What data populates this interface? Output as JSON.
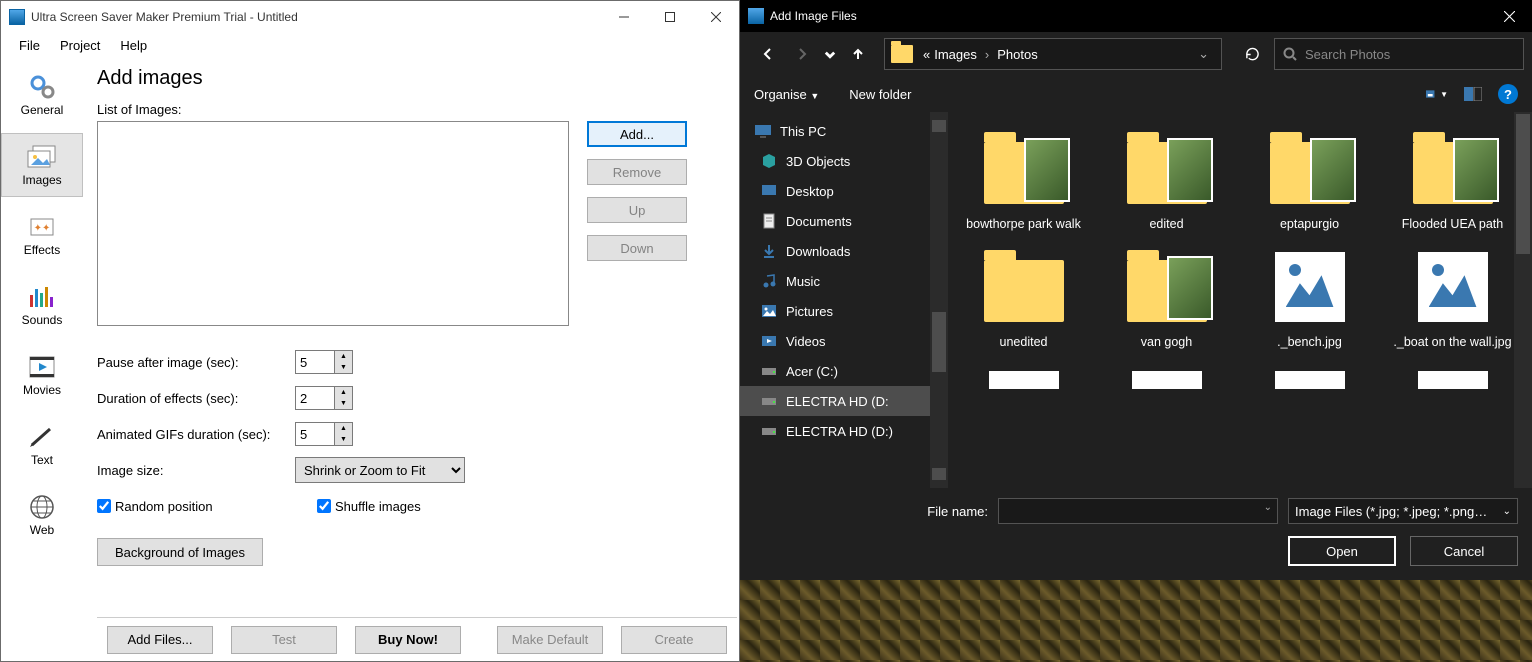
{
  "app": {
    "title": "Ultra Screen Saver Maker Premium Trial - Untitled",
    "menu": [
      "File",
      "Project",
      "Help"
    ],
    "sidebar": [
      {
        "label": "General"
      },
      {
        "label": "Images"
      },
      {
        "label": "Effects"
      },
      {
        "label": "Sounds"
      },
      {
        "label": "Movies"
      },
      {
        "label": "Text"
      },
      {
        "label": "Web"
      }
    ],
    "heading": "Add images",
    "list_label": "List of Images:",
    "list_buttons": {
      "add": "Add...",
      "remove": "Remove",
      "up": "Up",
      "down": "Down"
    },
    "settings": {
      "pause_label": "Pause after image (sec):",
      "pause_value": "5",
      "duration_label": "Duration of effects (sec):",
      "duration_value": "2",
      "gif_label": "Animated GIFs duration (sec):",
      "gif_value": "5",
      "size_label": "Image size:",
      "size_value": "Shrink or Zoom to Fit",
      "random_label": "Random position",
      "shuffle_label": "Shuffle images",
      "bg_btn": "Background of Images"
    },
    "footer": {
      "add": "Add Files...",
      "test": "Test",
      "buy": "Buy Now!",
      "default": "Make Default",
      "create": "Create"
    }
  },
  "dialog": {
    "title": "Add Image Files",
    "breadcrumb": {
      "prefix": "«",
      "seg1": "Images",
      "seg2": "Photos"
    },
    "search_placeholder": "Search Photos",
    "toolbar": {
      "organise": "Organise",
      "newfolder": "New folder"
    },
    "tree": [
      {
        "label": "This PC",
        "icon": "pc"
      },
      {
        "label": "3D Objects",
        "icon": "3d"
      },
      {
        "label": "Desktop",
        "icon": "desktop"
      },
      {
        "label": "Documents",
        "icon": "doc"
      },
      {
        "label": "Downloads",
        "icon": "dl"
      },
      {
        "label": "Music",
        "icon": "music"
      },
      {
        "label": "Pictures",
        "icon": "pic"
      },
      {
        "label": "Videos",
        "icon": "vid"
      },
      {
        "label": "Acer (C:)",
        "icon": "drive"
      },
      {
        "label": "ELECTRA HD (D:",
        "icon": "drive"
      },
      {
        "label": "ELECTRA HD (D:)",
        "icon": "drive"
      }
    ],
    "files": [
      {
        "name": "bowthorpe park walk",
        "type": "folder-img"
      },
      {
        "name": "edited",
        "type": "folder-img"
      },
      {
        "name": "eptapurgio",
        "type": "folder-img"
      },
      {
        "name": "Flooded UEA path",
        "type": "folder-img"
      },
      {
        "name": "unedited",
        "type": "folder"
      },
      {
        "name": "van gogh",
        "type": "folder-img"
      },
      {
        "name": "._bench.jpg",
        "type": "image"
      },
      {
        "name": "._boat on the wall.jpg",
        "type": "image"
      }
    ],
    "filename_label": "File name:",
    "filter": "Image Files (*.jpg; *.jpeg; *.png…",
    "open": "Open",
    "cancel": "Cancel"
  }
}
